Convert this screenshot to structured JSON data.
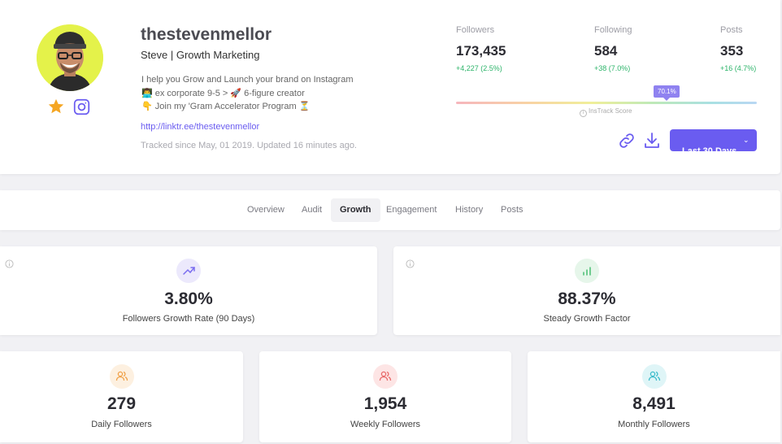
{
  "profile": {
    "username": "thestevenmellor",
    "full_name": "Steve | Growth Marketing",
    "bio_lines": [
      "I help you Grow and Launch your brand on Instagram",
      "👨‍💻 ex corporate 9-5 > 🚀 6-figure creator",
      "👇 Join my 'Gram Accelerator Program ⏳"
    ],
    "link": "http://linktr.ee/thestevenmellor",
    "tracked_text": "Tracked since May, 01 2019. Updated 16 minutes ago."
  },
  "stats": {
    "followers": {
      "label": "Followers",
      "value": "173,435",
      "change": "+4,227 (2.5%)"
    },
    "following": {
      "label": "Following",
      "value": "584",
      "change": "+38 (7.0%)"
    },
    "posts": {
      "label": "Posts",
      "value": "353",
      "change": "+16 (4.7%)"
    }
  },
  "score": {
    "badge": "70.1%",
    "fraction": 0.701,
    "label": "InsTrack Score"
  },
  "actions": {
    "period_label": "Last 30 Days",
    "accent_color": "#6a5cf0"
  },
  "tabs": [
    {
      "label": "Overview",
      "active": false
    },
    {
      "label": "Audit",
      "active": false
    },
    {
      "label": "Growth",
      "active": true
    },
    {
      "label": "Engagement",
      "active": false
    },
    {
      "label": "History",
      "active": false
    },
    {
      "label": "Posts",
      "active": false
    }
  ],
  "metrics": {
    "growth_rate": {
      "value": "3.80%",
      "label": "Followers Growth Rate (90 Days)",
      "icon": "trending-up-icon"
    },
    "steady": {
      "value": "88.37%",
      "label": "Steady Growth Factor",
      "icon": "bar-chart-icon"
    },
    "daily": {
      "value": "279",
      "label": "Daily Followers",
      "icon": "users-icon"
    },
    "weekly": {
      "value": "1,954",
      "label": "Weekly Followers",
      "icon": "users-icon"
    },
    "monthly": {
      "value": "8,491",
      "label": "Monthly Followers",
      "icon": "users-icon"
    }
  }
}
